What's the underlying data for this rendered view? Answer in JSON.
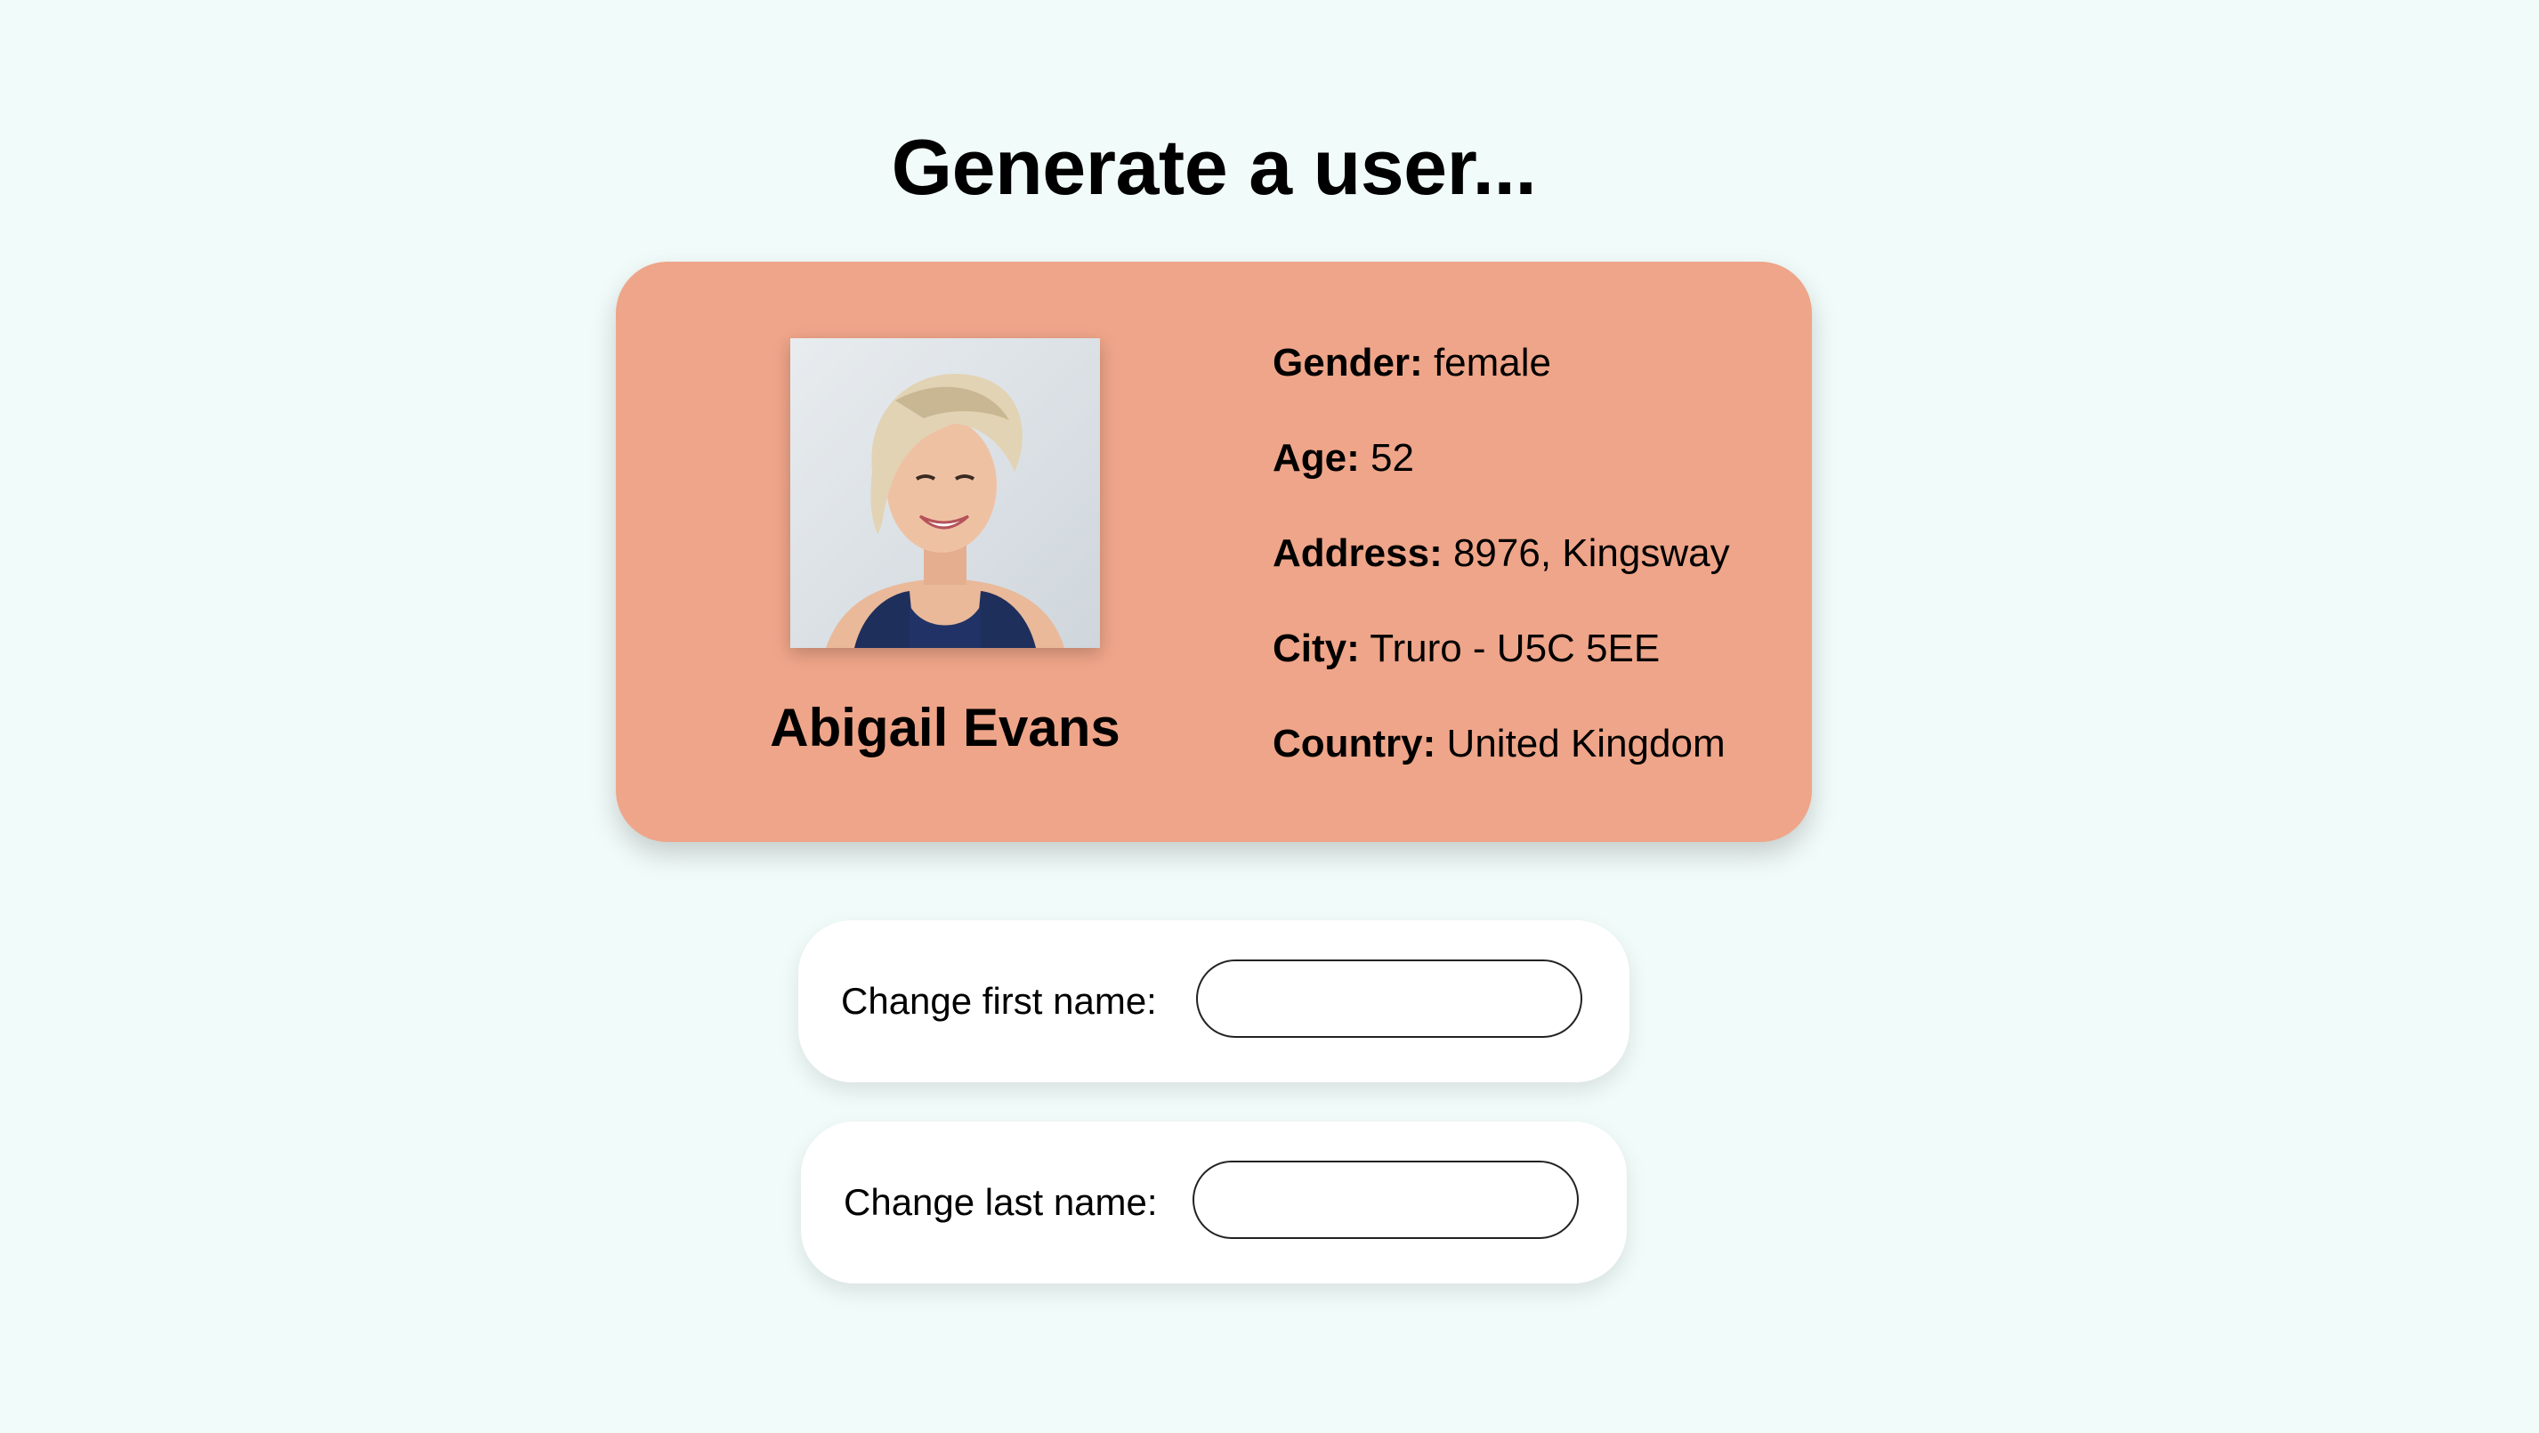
{
  "page": {
    "title": "Generate a user..."
  },
  "user": {
    "name": "Abigail Evans",
    "details": [
      {
        "label": "Gender:",
        "value": "female"
      },
      {
        "label": "Age:",
        "value": "52"
      },
      {
        "label": "Address:",
        "value": "8976, Kingsway"
      },
      {
        "label": "City:",
        "value": "Truro - U5C 5EE"
      },
      {
        "label": "Country:",
        "value": "United Kingdom"
      }
    ]
  },
  "form": {
    "first_name_label": "Change first name:",
    "first_name_value": "",
    "first_name_placeholder": "",
    "last_name_label": "Change last name:",
    "last_name_value": "",
    "last_name_placeholder": ""
  },
  "colors": {
    "background": "#f1fbf9",
    "card": "#efa589",
    "field_card": "#ffffff"
  }
}
